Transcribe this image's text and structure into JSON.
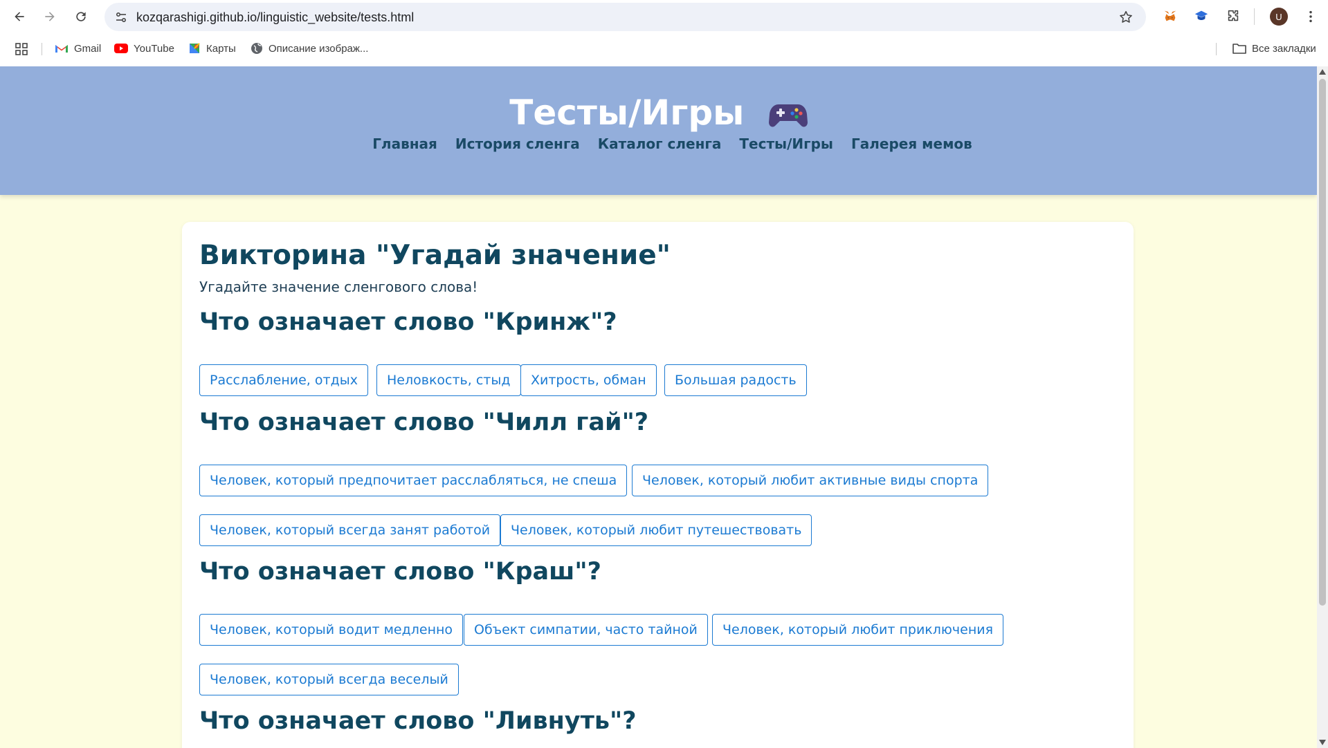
{
  "browser": {
    "url": "kozqarashigi.github.io/linguistic_website/tests.html",
    "avatar_letter": "U",
    "bookmarks": [
      {
        "label": "Gmail",
        "icon": "gmail-icon"
      },
      {
        "label": "YouTube",
        "icon": "youtube-icon"
      },
      {
        "label": "Карты",
        "icon": "maps-icon"
      },
      {
        "label": "Описание изображ...",
        "icon": "globe-icon"
      }
    ],
    "all_bookmarks": "Все закладки"
  },
  "header": {
    "title": "Тесты/Игры",
    "title_icon": "gamepad-icon",
    "nav": [
      "Главная",
      "История сленга",
      "Каталог сленга",
      "Тесты/Игры",
      "Галерея мемов"
    ]
  },
  "quiz": {
    "title": "Викторина \"Угадай значение\"",
    "subtitle": "Угадайте значение сленгового слова!",
    "questions": [
      {
        "question": "Что означает слово \"Кринж\"?",
        "options": [
          "Расслабление, отдых",
          "Неловкость, стыд",
          "Хитрость, обман",
          "Большая радость"
        ]
      },
      {
        "question": "Что означает слово \"Чилл гай\"?",
        "options": [
          "Человек, который предпочитает расслабляться, не спеша",
          "Человек, который любит активные виды спорта",
          "Человек, который всегда занят работой",
          "Человек, который любит путешествовать"
        ]
      },
      {
        "question": "Что означает слово \"Краш\"?",
        "options": [
          "Человек, который водит медленно",
          "Объект симпатии, часто тайной",
          "Человек, который любит приключения",
          "Человек, который всегда веселый"
        ]
      },
      {
        "question": "Что означает слово \"Ливнуть\"?",
        "options": []
      }
    ]
  },
  "colors": {
    "header_bg": "#93aedb",
    "page_bg": "#fdfde0",
    "heading": "#10475f",
    "nav_link": "#1a4a66",
    "option_accent": "#1b7ad2"
  }
}
